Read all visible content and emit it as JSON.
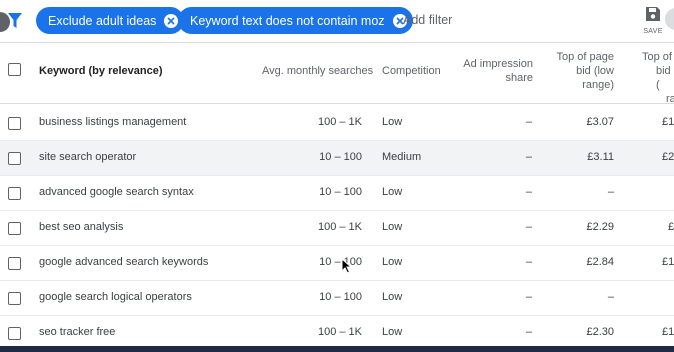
{
  "filters": {
    "chips": [
      {
        "label": "Exclude adult ideas"
      },
      {
        "label": "Keyword text does not contain moz"
      }
    ],
    "add_filter_label": "Add filter",
    "save_label": "SAVE"
  },
  "table": {
    "headers": {
      "keyword": "Keyword (by relevance)",
      "avg_searches": "Avg. monthly searches",
      "competition": "Competition",
      "ad_impression_line1": "Ad impression",
      "ad_impression_line2": "share",
      "bid_low_line1": "Top of page",
      "bid_low_line2": "bid (low",
      "bid_low_line3": "range)",
      "bid_high_line1": "Top of",
      "bid_high_line2": "bid (",
      "bid_high_line3": "ra"
    },
    "rows": [
      {
        "keyword": "business listings management",
        "searches": "100 – 1K",
        "competition": "Low",
        "impression": "–",
        "bid_low": "£3.07",
        "bid_high": "£1"
      },
      {
        "keyword": "site search operator",
        "searches": "10 – 100",
        "competition": "Medium",
        "impression": "–",
        "bid_low": "£3.11",
        "bid_high": "£2"
      },
      {
        "keyword": "advanced google search syntax",
        "searches": "10 – 100",
        "competition": "Low",
        "impression": "–",
        "bid_low": "–",
        "bid_high": ""
      },
      {
        "keyword": "best seo analysis",
        "searches": "100 – 1K",
        "competition": "Low",
        "impression": "–",
        "bid_low": "£2.29",
        "bid_high": "£"
      },
      {
        "keyword": "google advanced search keywords",
        "searches": "10 – 100",
        "competition": "Low",
        "impression": "–",
        "bid_low": "£2.84",
        "bid_high": "£1"
      },
      {
        "keyword": "google search logical operators",
        "searches": "10 – 100",
        "competition": "Low",
        "impression": "–",
        "bid_low": "–",
        "bid_high": ""
      },
      {
        "keyword": "seo tracker free",
        "searches": "100 – 1K",
        "competition": "Low",
        "impression": "–",
        "bid_low": "£2.30",
        "bid_high": "£1"
      }
    ]
  },
  "colors": {
    "chip_bg": "#1a73e8",
    "highlight_row": "#f1f3f4"
  }
}
